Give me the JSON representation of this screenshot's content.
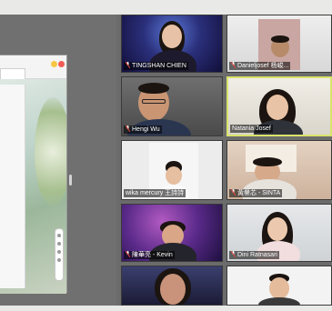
{
  "participants": [
    {
      "name": "TINGSHAN CHIEN",
      "muted": true
    },
    {
      "name": "Danieljosef 杨峻...",
      "muted": true
    },
    {
      "name": "Hengi Wu",
      "muted": true
    },
    {
      "name": "Natania Josef",
      "muted": false,
      "active_speaker": true
    },
    {
      "name": "wika mercury 王詩詩",
      "muted": false
    },
    {
      "name": "黃譽芯 - SINTA",
      "muted": true
    },
    {
      "name": "陳華亮 - Kevin",
      "muted": true
    },
    {
      "name": "Dini Ratnasari",
      "muted": true
    },
    {
      "name": "",
      "muted": false
    },
    {
      "name": "",
      "muted": false
    }
  ],
  "colors": {
    "active_speaker_border": "#d9e36a",
    "muted_mic": "#e0453a",
    "nameplate_bg": "rgba(0,0,0,0.55)"
  },
  "icons": {
    "muted": "mic-muted-icon"
  }
}
